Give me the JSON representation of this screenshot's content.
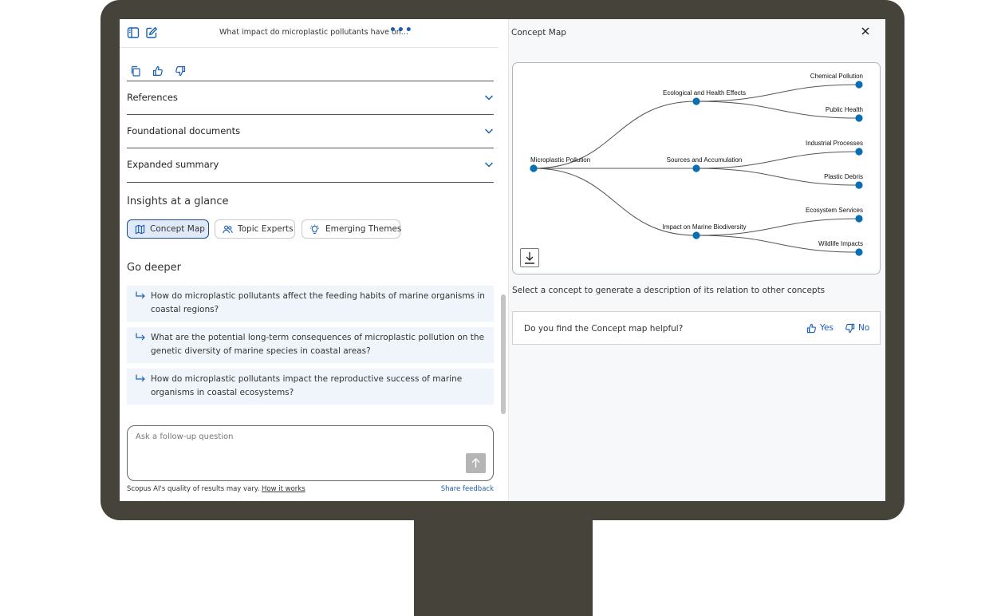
{
  "thread": {
    "title": "What impact do microplastic pollutants have on...",
    "more_label": "•••"
  },
  "accordion": [
    {
      "label": "References"
    },
    {
      "label": "Foundational documents"
    },
    {
      "label": "Expanded summary"
    }
  ],
  "insights": {
    "heading": "Insights at a glance",
    "pills": [
      {
        "label": "Concept Map",
        "icon": "map-icon",
        "active": true
      },
      {
        "label": "Topic Experts",
        "icon": "people-icon",
        "active": false
      },
      {
        "label": "Emerging Themes",
        "icon": "lightbulb-icon",
        "active": false
      }
    ]
  },
  "go_deeper": {
    "heading": "Go deeper",
    "questions": [
      "How do microplastic pollutants affect the feeding habits of marine organisms in coastal regions?",
      "What are the potential long-term consequences of microplastic pollution on the genetic diversity of marine species in coastal areas?",
      "How do microplastic pollutants impact the reproductive success of marine organisms in coastal ecosystems?"
    ]
  },
  "ask": {
    "placeholder": "Ask a follow-up question"
  },
  "footer": {
    "disclaimer": "Scopus AI's quality of results may vary.",
    "how_link": "How it works",
    "feedback_link": "Share feedback"
  },
  "concept_map": {
    "title": "Concept Map",
    "hint": "Select a concept to generate a description of its relation to other concepts",
    "accent": "#0a6eb4",
    "root": "Microplastic Pollution",
    "branches": [
      {
        "label": "Ecological and Health Effects",
        "children": [
          "Chemical Pollution",
          "Public Health"
        ]
      },
      {
        "label": "Sources and Accumulation",
        "children": [
          "Industrial Processes",
          "Plastic Debris"
        ]
      },
      {
        "label": "Impact on Marine Biodiversity",
        "children": [
          "Ecosystem Services",
          "Wildlife Impacts"
        ]
      }
    ]
  },
  "feedback": {
    "question": "Do you find the Concept map helpful?",
    "yes": "Yes",
    "no": "No"
  }
}
